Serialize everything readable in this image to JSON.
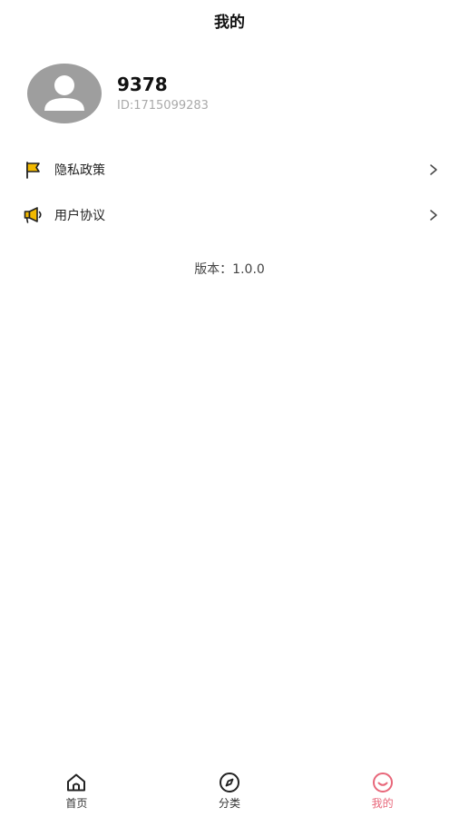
{
  "header": {
    "title": "我的"
  },
  "profile": {
    "name": "9378",
    "id_text": "ID:1715099283"
  },
  "menu": {
    "items": [
      {
        "label": "隐私政策",
        "icon": "flag-icon"
      },
      {
        "label": "用户协议",
        "icon": "megaphone-icon"
      }
    ]
  },
  "version": {
    "text": "版本：1.0.0"
  },
  "tabbar": {
    "active_color": "#e8677a",
    "icon_accent": "#f2b900",
    "tabs": [
      {
        "label": "首页",
        "icon": "home-icon",
        "active": false
      },
      {
        "label": "分类",
        "icon": "compass-icon",
        "active": false
      },
      {
        "label": "我的",
        "icon": "smile-icon",
        "active": true
      }
    ]
  }
}
